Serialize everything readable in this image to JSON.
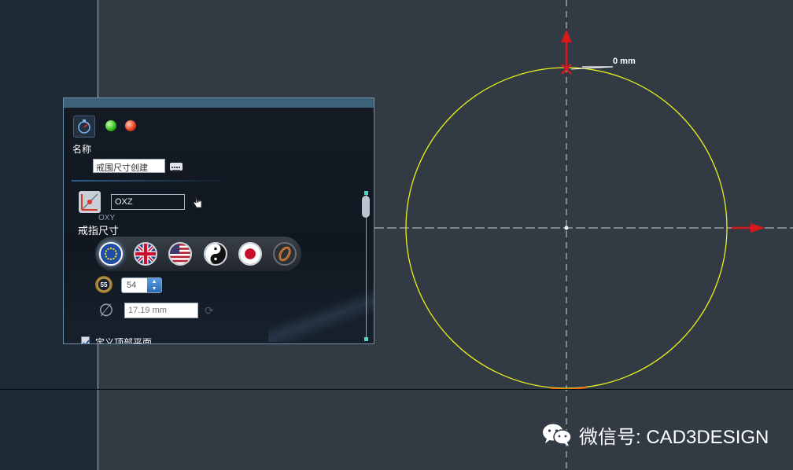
{
  "viewport": {
    "dimension_label": "0 mm",
    "watermark": "微信号: CAD3DESIGN"
  },
  "panel": {
    "name_label": "名称",
    "name_value": "戒围尺寸创建",
    "plane_value": "OXZ",
    "plane_sublabel": "OXY",
    "ring_size_label": "戒指尺寸",
    "flags": [
      "eu-flag",
      "uk-flag",
      "us-flag",
      "yin-yang",
      "japan-flag",
      "ring"
    ],
    "size_badge": "55",
    "size_value": "54",
    "diameter_value": "17.19 mm",
    "option_label": "定义顶部平面"
  },
  "colors": {
    "background": "#323b44",
    "circle": "#e9f01c",
    "axis_arrow": "#d8191c",
    "panel_title": "#3d6177"
  },
  "icons": {
    "app": "compass-icon",
    "green": "green-status-icon",
    "red": "red-status-icon",
    "keyboard": "keyboard-icon",
    "plane": "plane-icon",
    "cursor": "hand-cursor-icon",
    "diameter": "diameter-icon",
    "refresh": "refresh-icon",
    "watermark": "wechat-icon"
  }
}
